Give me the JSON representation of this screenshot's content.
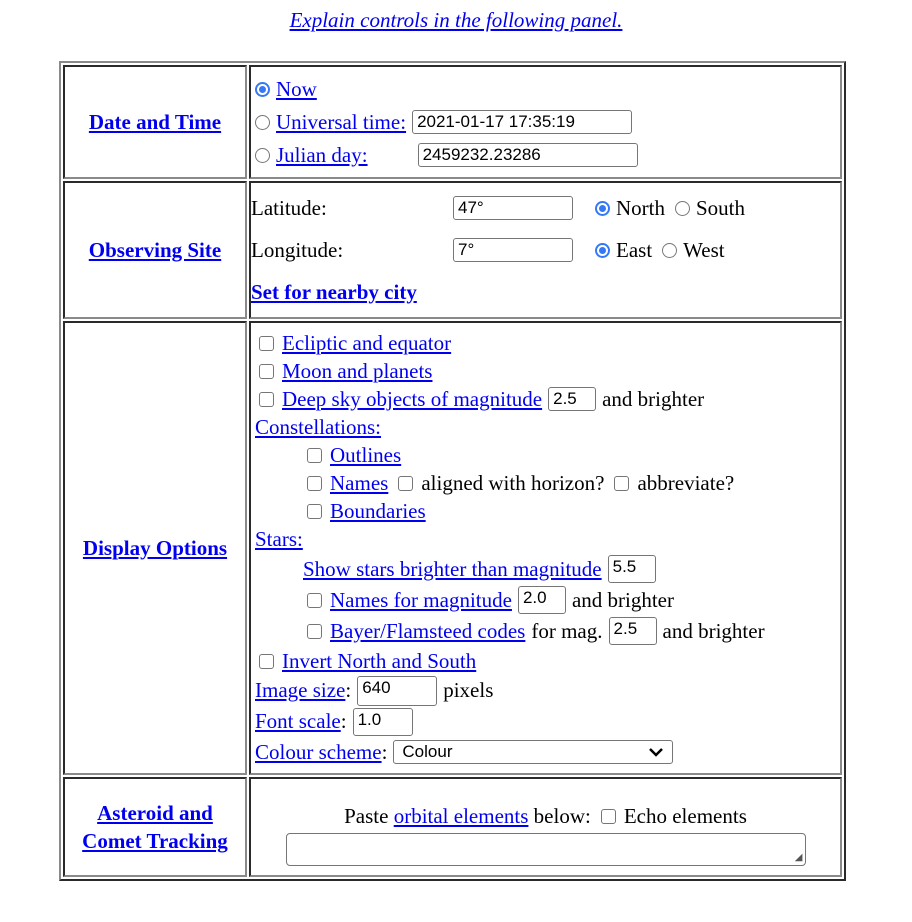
{
  "header": {
    "explain_link": "Explain controls in the following panel."
  },
  "date_time": {
    "label": "Date and Time",
    "now_label": "Now",
    "ut_label": "Universal time:",
    "ut_value": "2021-01-17 17:35:19",
    "jd_label": "Julian day:",
    "jd_value": "2459232.23286",
    "selected": "now"
  },
  "site": {
    "label": "Observing Site",
    "latitude_label": "Latitude:",
    "latitude_value": "47°",
    "north_label": "North",
    "south_label": "South",
    "longitude_label": "Longitude:",
    "longitude_value": "7°",
    "east_label": "East",
    "west_label": "West",
    "city_link": "Set for nearby city"
  },
  "display": {
    "label": "Display Options",
    "ecliptic": "Ecliptic and equator",
    "moon": "Moon and planets",
    "deepsky": "Deep sky objects of magnitude",
    "deepsky_value": "2.5",
    "and_brighter": "and brighter",
    "constellations": "Constellations:",
    "outlines": "Outlines",
    "names": "Names",
    "aligned": "aligned with horizon?",
    "abbreviate": "abbreviate?",
    "boundaries": "Boundaries",
    "stars": "Stars:",
    "show_stars": "Show stars brighter than magnitude",
    "show_stars_value": "5.5",
    "names_mag": "Names for magnitude",
    "names_mag_value": "2.0",
    "bayer": "Bayer/Flamsteed codes",
    "for_mag": "for mag.",
    "bayer_value": "2.5",
    "invert": "Invert North and South",
    "image_size": "Image size",
    "image_size_value": "640",
    "pixels": "pixels",
    "font_scale": "Font scale",
    "font_scale_value": "1.0",
    "colour_scheme": "Colour scheme",
    "colour_scheme_value": "Colour",
    "colon": ":"
  },
  "asteroid": {
    "label_line1": "Asteroid and",
    "label_line2": "Comet Tracking",
    "paste": "Paste",
    "orbital": "orbital elements",
    "below": "below:",
    "echo": "Echo elements",
    "textarea_value": ""
  }
}
